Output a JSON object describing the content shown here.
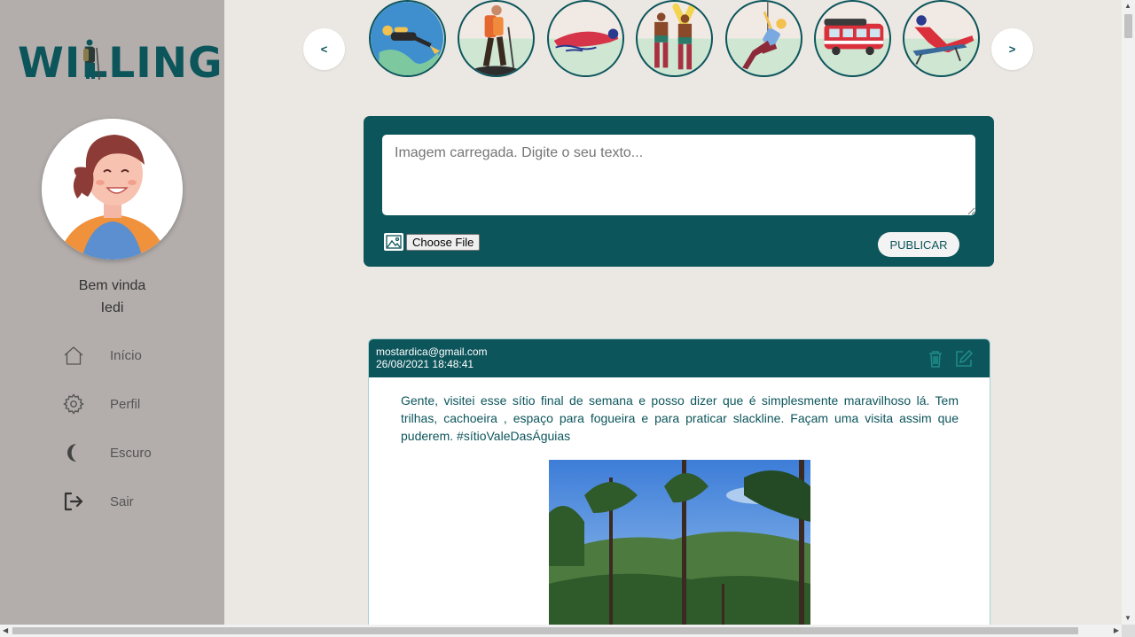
{
  "app": {
    "logo_text": "WILLING"
  },
  "sidebar": {
    "greeting": "Bem vinda",
    "username": "Iedi",
    "items": [
      {
        "label": "Início",
        "icon": "home-icon"
      },
      {
        "label": "Perfil",
        "icon": "gear-icon"
      },
      {
        "label": "Escuro",
        "icon": "moon-icon"
      },
      {
        "label": "Sair",
        "icon": "logout-icon"
      }
    ]
  },
  "carousel": {
    "prev_label": "<",
    "next_label": ">",
    "stories": [
      "diving",
      "hiking",
      "swimming",
      "surfing",
      "climbing",
      "camper-van",
      "sunbathing"
    ]
  },
  "composer": {
    "placeholder": "Imagem carregada. Digite o seu texto...",
    "file_button": "Choose File",
    "publish_label": "PUBLICAR"
  },
  "post": {
    "email": "mostardica@gmail.com",
    "date": "26/08/2021 18:48:41",
    "text": "Gente, visitei esse sítio final de semana e posso dizer que é simplesmente maravilhoso lá. Tem trilhas, cachoeira , espaço para fogueira e para praticar slackline. Façam uma visita assim que puderem. #sítioValeDasÁguias"
  },
  "colors": {
    "primary": "#0c555b",
    "sidebar_bg": "#b3aeac",
    "page_bg": "#ebe7e3"
  }
}
